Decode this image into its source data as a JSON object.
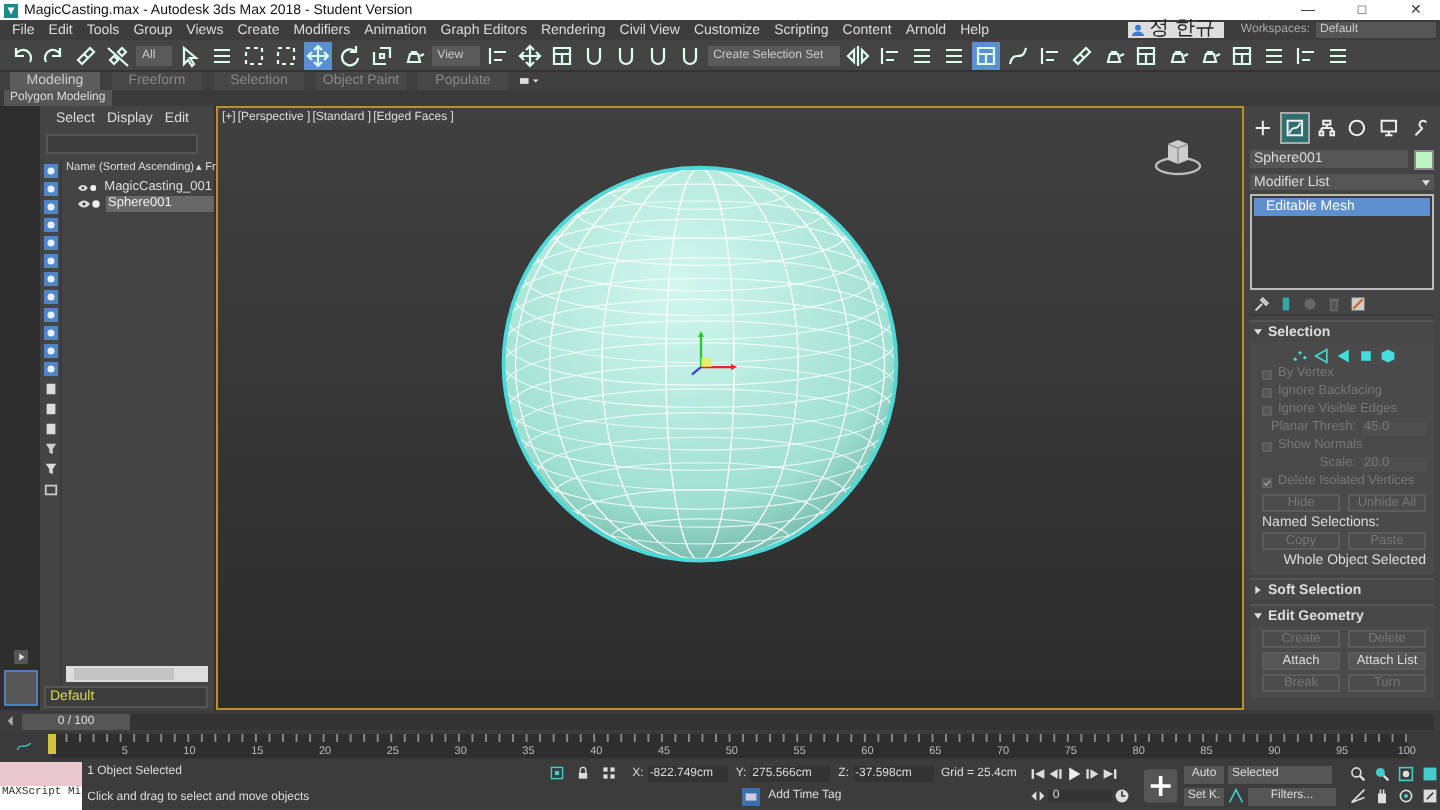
{
  "window": {
    "title": "MagicCasting.max - Autodesk 3ds Max 2018 - Student Version",
    "controls": [
      "—",
      "□",
      "✕"
    ]
  },
  "menu": [
    "File",
    "Edit",
    "Tools",
    "Group",
    "Views",
    "Create",
    "Modifiers",
    "Animation",
    "Graph Editors",
    "Rendering",
    "Civil View",
    "Customize",
    "Scripting",
    "Content",
    "Arnold",
    "Help"
  ],
  "user": "정 한규",
  "workspaces": {
    "label": "Workspaces:",
    "value": "Default"
  },
  "toolbar": [
    {
      "kind": "undo",
      "selected": false
    },
    {
      "kind": "redo",
      "selected": false
    },
    {
      "kind": "link",
      "selected": false
    },
    {
      "kind": "unlink",
      "selected": false
    },
    {
      "kind": "dropdown",
      "value": "All"
    },
    {
      "kind": "select",
      "selected": false
    },
    {
      "kind": "list",
      "selected": false
    },
    {
      "kind": "region",
      "selected": false
    },
    {
      "kind": "region",
      "selected": false
    },
    {
      "kind": "move",
      "selected": true
    },
    {
      "kind": "rotate",
      "selected": false
    },
    {
      "kind": "scale",
      "selected": false
    },
    {
      "kind": "teapot",
      "selected": false
    },
    {
      "kind": "dropdown",
      "value": "View"
    },
    {
      "kind": "align",
      "selected": false
    },
    {
      "kind": "move",
      "selected": false
    },
    {
      "kind": "table",
      "selected": false
    },
    {
      "kind": "magnet",
      "selected": false
    },
    {
      "kind": "magnet",
      "selected": false
    },
    {
      "kind": "magnet",
      "selected": false
    },
    {
      "kind": "magnet",
      "selected": false
    },
    {
      "kind": "dropdown",
      "value": "Create Selection Set"
    },
    {
      "kind": "mirror",
      "selected": false
    },
    {
      "kind": "align",
      "selected": false
    },
    {
      "kind": "list",
      "selected": false
    },
    {
      "kind": "list",
      "selected": false
    },
    {
      "kind": "table",
      "selected": true
    },
    {
      "kind": "curve",
      "selected": false
    },
    {
      "kind": "align",
      "selected": false
    },
    {
      "kind": "link",
      "selected": false
    },
    {
      "kind": "teapot",
      "selected": false
    },
    {
      "kind": "table",
      "selected": false
    },
    {
      "kind": "teapot",
      "selected": false
    },
    {
      "kind": "teapot",
      "selected": false
    },
    {
      "kind": "table",
      "selected": false
    },
    {
      "kind": "list",
      "selected": false
    },
    {
      "kind": "align",
      "selected": false
    },
    {
      "kind": "list",
      "selected": false
    }
  ],
  "ribbon": {
    "tabs": [
      {
        "label": "Modeling",
        "selected": true
      },
      {
        "label": "Freeform",
        "selected": false
      },
      {
        "label": "Selection",
        "selected": false
      },
      {
        "label": "Object Paint",
        "selected": false
      },
      {
        "label": "Populate",
        "selected": false
      }
    ],
    "panel": "Polygon Modeling"
  },
  "explorer": {
    "menu": [
      "Select",
      "Display",
      "Edit"
    ],
    "filters": [
      {
        "on": true
      },
      {
        "on": true
      },
      {
        "on": true
      },
      {
        "on": true
      },
      {
        "on": true
      },
      {
        "on": true
      },
      {
        "on": true
      },
      {
        "on": true
      },
      {
        "on": true
      },
      {
        "on": true
      },
      {
        "on": true
      },
      {
        "on": true
      }
    ],
    "column": "Name (Sorted Ascending)",
    "column_2": "▴ Fr",
    "items": [
      {
        "name": "MagicCasting_001",
        "selected": false
      },
      {
        "name": "Sphere001",
        "selected": true
      }
    ],
    "layer": "Default"
  },
  "viewport": {
    "labels": [
      "[+]",
      "[Perspective ]",
      "[Standard ]",
      "[Edged Faces ]"
    ],
    "active": true
  },
  "command_panel": {
    "tabs": [
      {
        "kind": "create",
        "selected": false
      },
      {
        "kind": "modify",
        "selected": true
      },
      {
        "kind": "hierarchy",
        "selected": false
      },
      {
        "kind": "motion",
        "selected": false
      },
      {
        "kind": "display",
        "selected": false
      },
      {
        "kind": "utilities",
        "selected": false
      }
    ],
    "object_name": "Sphere001",
    "modifier_list": "Modifier List",
    "stack": [
      {
        "label": "Editable Mesh",
        "selected": true
      }
    ],
    "rollouts": [
      {
        "title": "Selection",
        "expanded": true,
        "controls": [
          {
            "kind": "subobjects"
          },
          {
            "kind": "checkbox",
            "label": "By Vertex",
            "checked": false,
            "disabled": true
          },
          {
            "kind": "checkbox",
            "label": "Ignore Backfacing",
            "checked": false,
            "disabled": true
          },
          {
            "kind": "checkbox",
            "label": "Ignore Visible Edges",
            "checked": false,
            "disabled": true
          },
          {
            "kind": "spinner",
            "label": "Planar Thresh:",
            "value": "45.0",
            "disabled": true
          },
          {
            "kind": "checkbox",
            "label": "Show Normals",
            "checked": false,
            "disabled": true
          },
          {
            "kind": "spinner",
            "label": "Scale:",
            "value": "20.0",
            "disabled": true
          },
          {
            "kind": "checkbox",
            "label": "Delete Isolated Vertices",
            "checked": true,
            "disabled": true
          },
          {
            "kind": "buttons",
            "items": [
              {
                "label": "Hide",
                "disabled": true
              },
              {
                "label": "Unhide All",
                "disabled": true
              }
            ]
          },
          {
            "kind": "label",
            "text": "Named Selections:"
          },
          {
            "kind": "buttons",
            "items": [
              {
                "label": "Copy",
                "disabled": true
              },
              {
                "label": "Paste",
                "disabled": true
              }
            ]
          },
          {
            "kind": "note",
            "text": "Whole Object Selected"
          }
        ]
      },
      {
        "title": "Soft Selection",
        "expanded": false
      },
      {
        "title": "Edit Geometry",
        "expanded": true,
        "controls": [
          {
            "kind": "buttons",
            "items": [
              {
                "label": "Create",
                "disabled": true
              },
              {
                "label": "Delete",
                "disabled": true
              }
            ]
          },
          {
            "kind": "buttons",
            "items": [
              {
                "label": "Attach",
                "disabled": false
              },
              {
                "label": "Attach List",
                "disabled": false
              }
            ]
          },
          {
            "kind": "buttons",
            "items": [
              {
                "label": "Break",
                "disabled": true
              },
              {
                "label": "Turn",
                "disabled": true
              }
            ]
          }
        ]
      }
    ]
  },
  "timeline": {
    "frame": "0 / 100",
    "ticks": [
      "5",
      "10",
      "15",
      "20",
      "25",
      "30",
      "35",
      "40",
      "45",
      "50",
      "55",
      "60",
      "65",
      "70",
      "75",
      "80",
      "85",
      "90",
      "95",
      "100"
    ]
  },
  "status": {
    "maxscript": "MAXScript Mi",
    "selection": "1 Object Selected",
    "prompt": "Click and drag to select and move objects",
    "coords": [
      {
        "label": "X:",
        "value": "-822.749cm"
      },
      {
        "label": "Y:",
        "value": "275.566cm"
      },
      {
        "label": "Z:",
        "value": "-37.598cm"
      }
    ],
    "grid": "Grid = 25.4cm",
    "time_tag": "Add Time Tag",
    "frame": "0",
    "auto": "Auto",
    "key_filter": "Selected",
    "set_key": "Set K.",
    "filters": "Filters..."
  }
}
